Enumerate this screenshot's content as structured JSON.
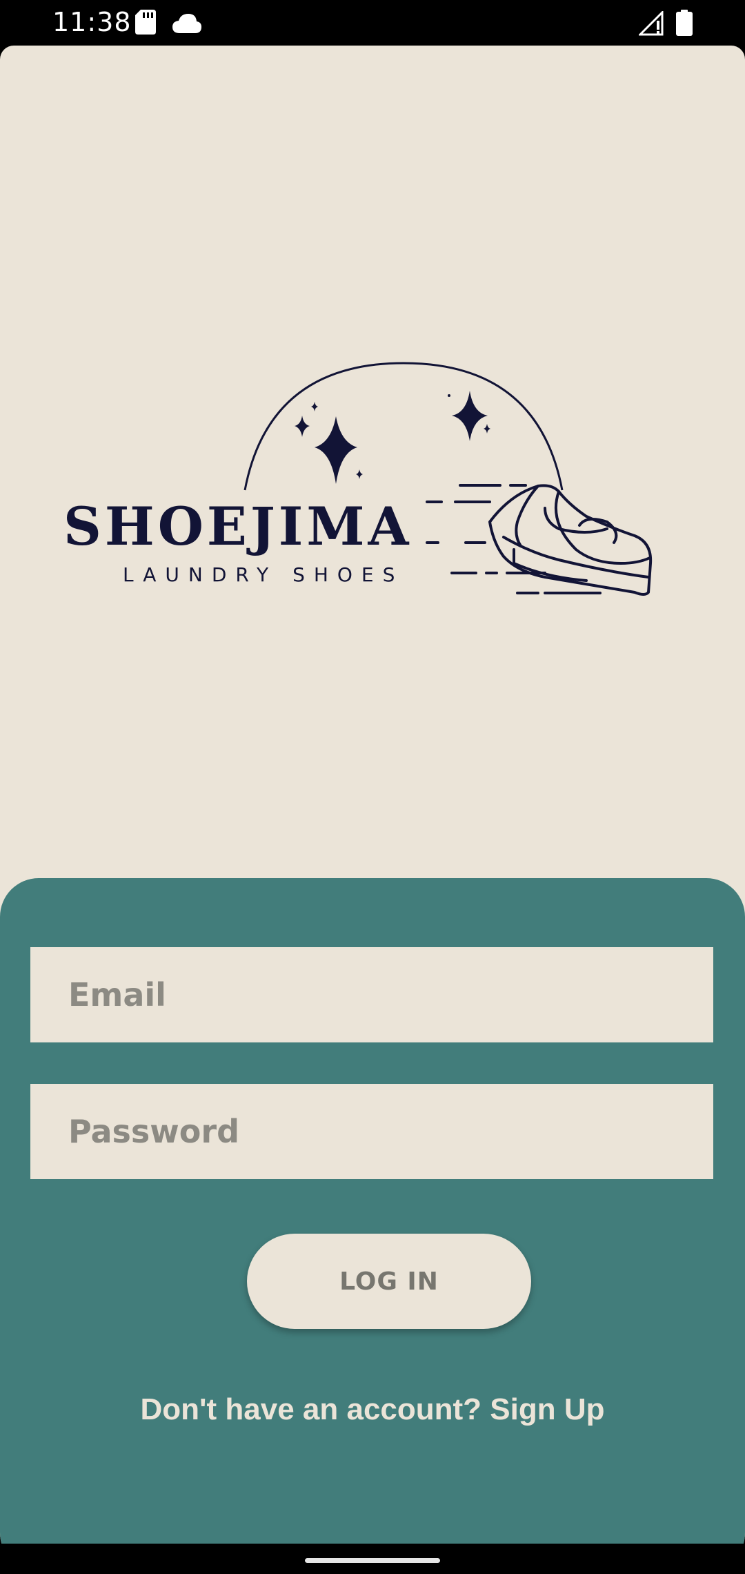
{
  "status_bar": {
    "time": "11:38",
    "icons": [
      "sd-card-icon",
      "cloud-icon",
      "signal-icon",
      "battery-icon"
    ]
  },
  "logo": {
    "name": "SHOEJIMA",
    "tagline": "LAUNDRY SHOES",
    "color": "#121436"
  },
  "form": {
    "email_placeholder": "Email",
    "password_placeholder": "Password",
    "login_label": "LOG IN",
    "signup_text": "Don't have an account? Sign Up"
  },
  "colors": {
    "background": "#ebe4d8",
    "panel": "#427d7b",
    "placeholder": "#8c8a83",
    "text_light": "#ebe4d8"
  }
}
